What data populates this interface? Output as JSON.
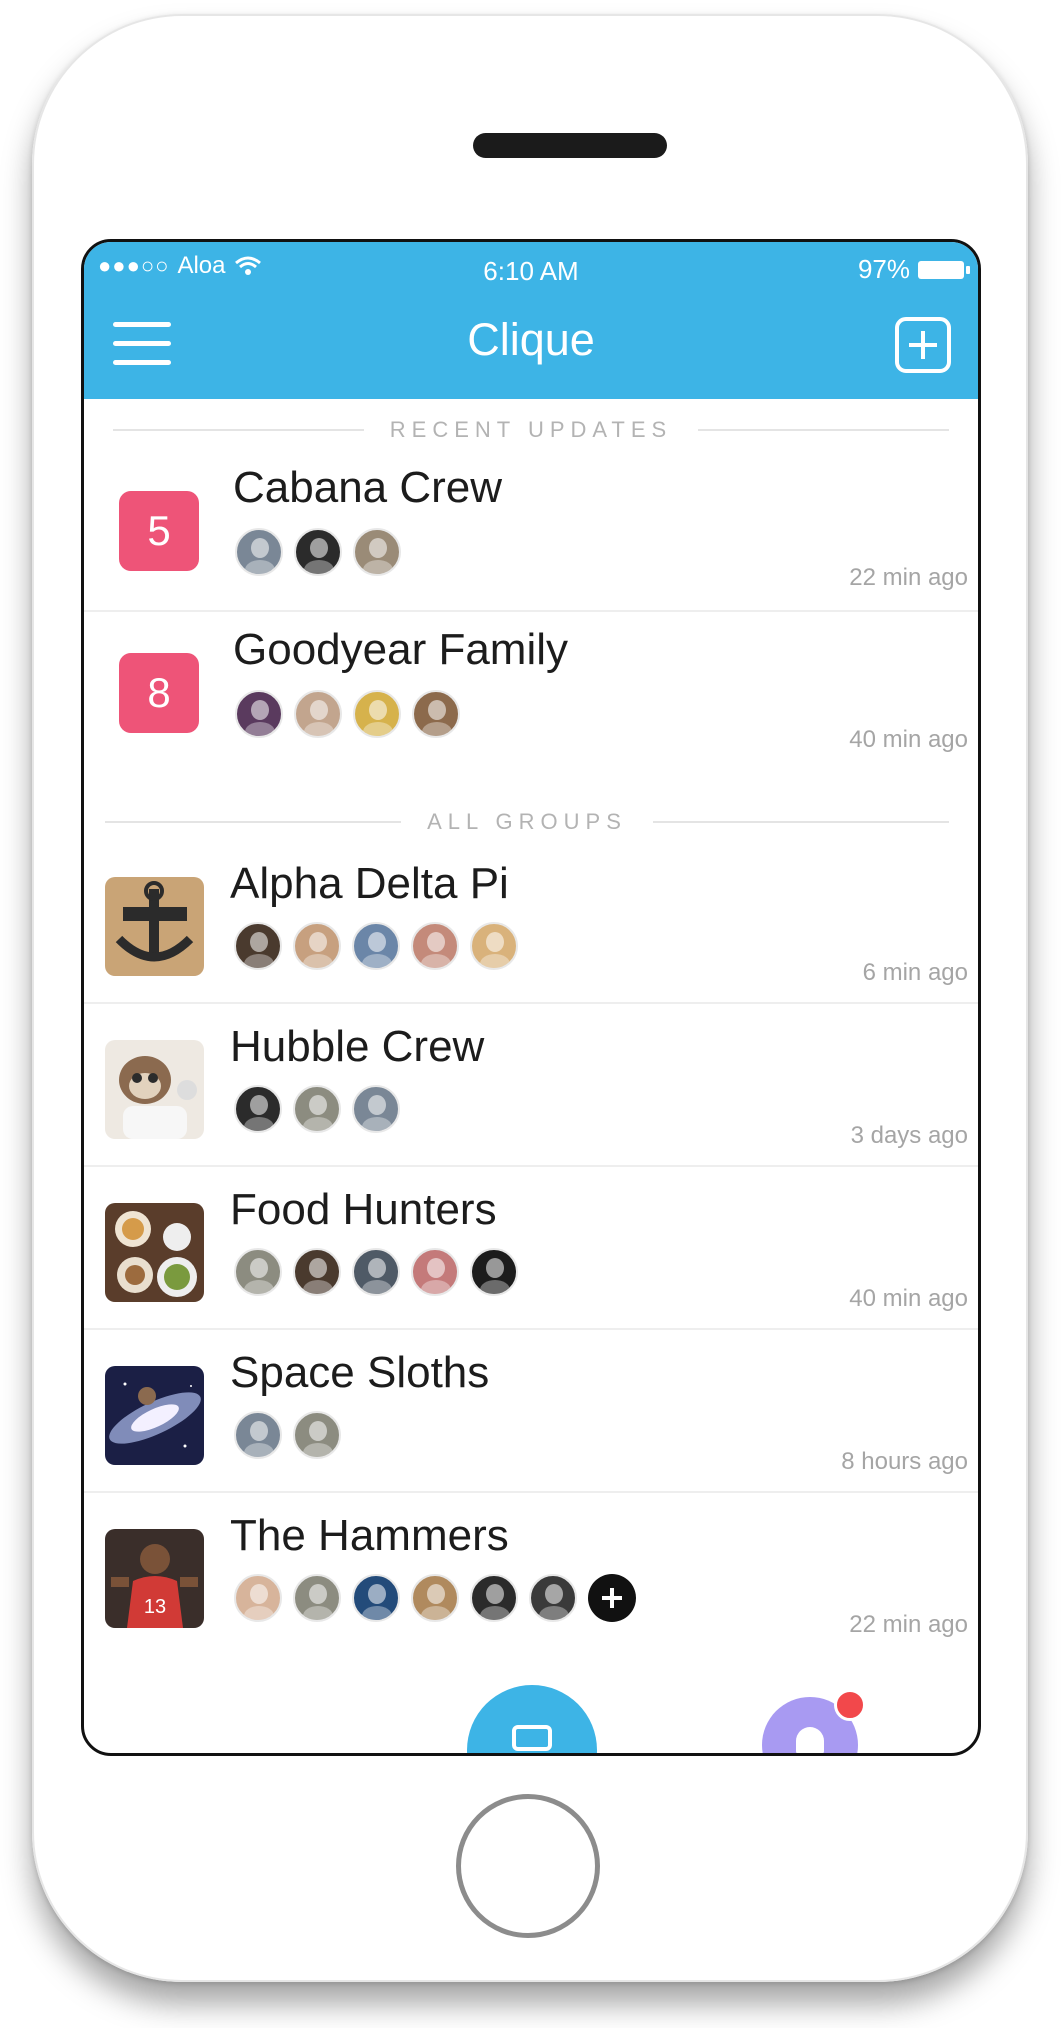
{
  "status_bar": {
    "carrier": "Aloa",
    "time": "6:10 AM",
    "battery": "97%"
  },
  "header": {
    "title": "Clique"
  },
  "sections": {
    "recent": "RECENT UPDATES",
    "all": "ALL GROUPS"
  },
  "recent": [
    {
      "badge": "5",
      "name": "Cabana Crew",
      "time": "22 min ago",
      "avatars": [
        "#7a8796",
        "#2b2b2b",
        "#9a8b77"
      ]
    },
    {
      "badge": "8",
      "name": "Goodyear Family",
      "time": "40 min ago",
      "avatars": [
        "#5a3a5e",
        "#c2a58e",
        "#d6b24c",
        "#8c6a4c"
      ]
    }
  ],
  "groups": [
    {
      "name": "Alpha Delta Pi",
      "time": "6 min ago",
      "thumb": "anchor",
      "avatars": [
        "#4a3a2e",
        "#c7a07f",
        "#6b86a8",
        "#c48a7a",
        "#d9b27b"
      ]
    },
    {
      "name": "Hubble Crew",
      "time": "3 days ago",
      "thumb": "sloth",
      "avatars": [
        "#2b2b2b",
        "#8c8c80",
        "#7a8796"
      ]
    },
    {
      "name": "Food Hunters",
      "time": "40 min ago",
      "thumb": "food",
      "avatars": [
        "#8c8c80",
        "#4a3a2e",
        "#4f5a66",
        "#c47a7a",
        "#1c1c1c"
      ]
    },
    {
      "name": "Space Sloths",
      "time": "8 hours ago",
      "thumb": "galaxy",
      "avatars": [
        "#7a8796",
        "#8c8c80"
      ]
    },
    {
      "name": "The Hammers",
      "time": "22 min ago",
      "thumb": "basketball",
      "avatars": [
        "#d7b49b",
        "#8c8c80",
        "#234b7a",
        "#b08a5e",
        "#2b2b2b",
        "#3a3a3a"
      ],
      "more": true
    }
  ],
  "colors": {
    "accent": "#3db4e6",
    "badge": "#ee5478",
    "notification": "#f2484b",
    "fab_secondary": "#a89af2"
  }
}
